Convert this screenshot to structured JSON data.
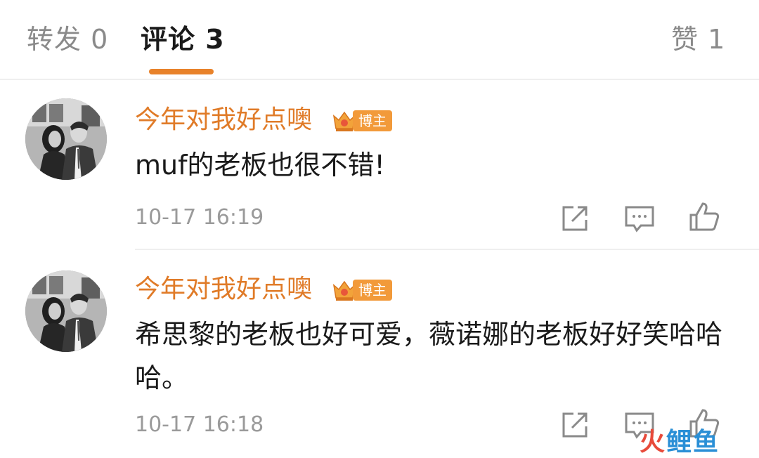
{
  "tabs": [
    {
      "label": "转发 0"
    },
    {
      "label": "评论 3"
    },
    {
      "label": "赞 1"
    }
  ],
  "colors": {
    "accent": "#e8822a",
    "username": "#e07b28",
    "badge": "#f29a3a"
  },
  "comments": [
    {
      "username": "今年对我好点噢",
      "badge": "博主",
      "text": "muf的老板也很不错!",
      "time": "10-17 16:19"
    },
    {
      "username": "今年对我好点噢",
      "badge": "博主",
      "text": "希思黎的老板也好可爱，薇诺娜的老板好好笑哈哈哈。",
      "time": "10-17 16:18"
    }
  ],
  "actions": {
    "icons": [
      "share-icon",
      "comment-icon",
      "like-icon"
    ]
  },
  "watermark": {
    "part1": "火",
    "part2": "鲤鱼"
  }
}
